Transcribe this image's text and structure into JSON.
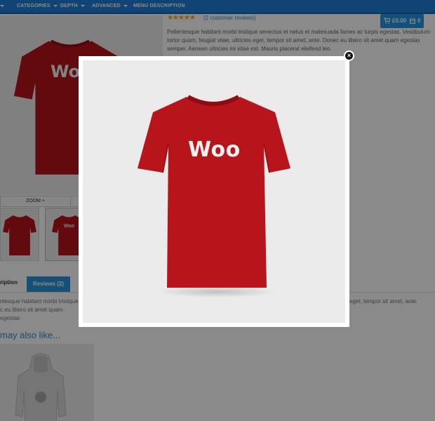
{
  "nav": {
    "items": [
      {
        "label": "CATEGORIES",
        "has_caret": true
      },
      {
        "label": "DEPTH",
        "has_caret": true
      },
      {
        "label": "ADVANCED",
        "has_caret": true
      },
      {
        "label": "MENU DESCRIPTION",
        "has_caret": false
      }
    ]
  },
  "product": {
    "stars": "★★★★★",
    "reviews_link": "(2 customer reviews)",
    "description": "Pellentesque habitant morbi tristique senectus et netus et malesuada fames ac turpis egestas. Vestibulum tortor quam, feugiat vitae, ultricies eget, tempor sit amet, ante. Donec eu libero sit amet quam egestas semper. Aenean ultricies mi vitae est. Mauris placerat eleifend leo.",
    "shirt_text": "Woo",
    "zoom_label": "ZOOM +"
  },
  "cart": {
    "amount": "£0.00",
    "count": "0",
    "cart_icon": "cart-icon",
    "bag_icon": "bag-icon"
  },
  "tabs": {
    "description_label": "ription",
    "reviews_label": "Reviews (2)",
    "body_left_1": "ntesque habitant morbi tristique",
    "body_left_2": "c eu libero sit amet quam egestas",
    "body_right": "eget, tempor sit amet, ante."
  },
  "related": {
    "heading": "may also like..."
  },
  "lightbox": {
    "shirt_text": "Woo",
    "close_icon": "close-icon",
    "shirt_color": "#b8141b"
  },
  "colors": {
    "nav_bg": "#1e7fd6",
    "accent": "#2a92dc",
    "star": "#f0ad1c"
  }
}
